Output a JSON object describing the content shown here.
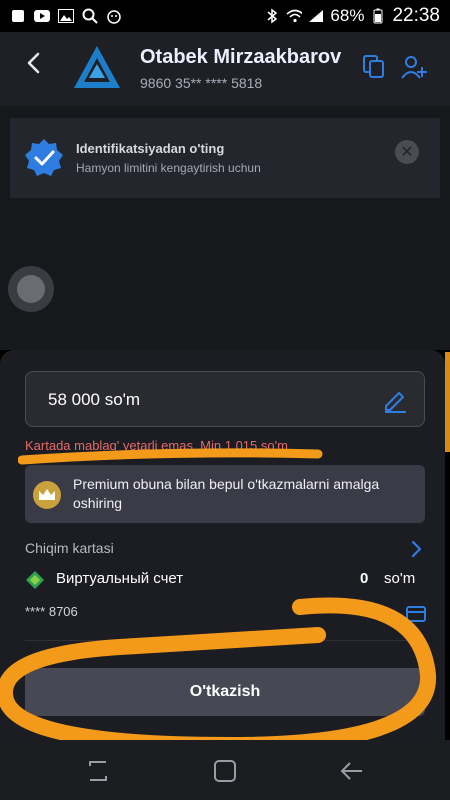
{
  "status_bar": {
    "battery": "68%",
    "time": "22:38",
    "icons": [
      "app-icon",
      "youtube-icon",
      "image-icon",
      "search-icon",
      "dog-icon",
      "bluetooth-icon",
      "wifi-icon",
      "signal-icon",
      "battery-icon"
    ]
  },
  "header": {
    "name": "Otabek Mirzaakbarov",
    "card_number": "9860 35** **** 5818"
  },
  "banner": {
    "title": "Identifikatsiyadan o'ting",
    "subtitle": "Hamyon limitini kengaytirish uchun"
  },
  "sheet": {
    "amount": "58 000 so'm",
    "error": "Kartada mablag' yetarli emas. Min 1 015 so'm",
    "promo": "Premium obuna bilan bepul o'tkazmalarni amalga oshiring",
    "section_label": "Chiqim kartasi",
    "wallet_name": "Виртуальный счет",
    "balance": "0",
    "currency": "so'm",
    "masked_card": "**** 8706",
    "cta": "O'tkazish"
  },
  "colors": {
    "accent": "#2f7de1",
    "error": "#e46a6a",
    "annotation": "#f39a1a"
  }
}
